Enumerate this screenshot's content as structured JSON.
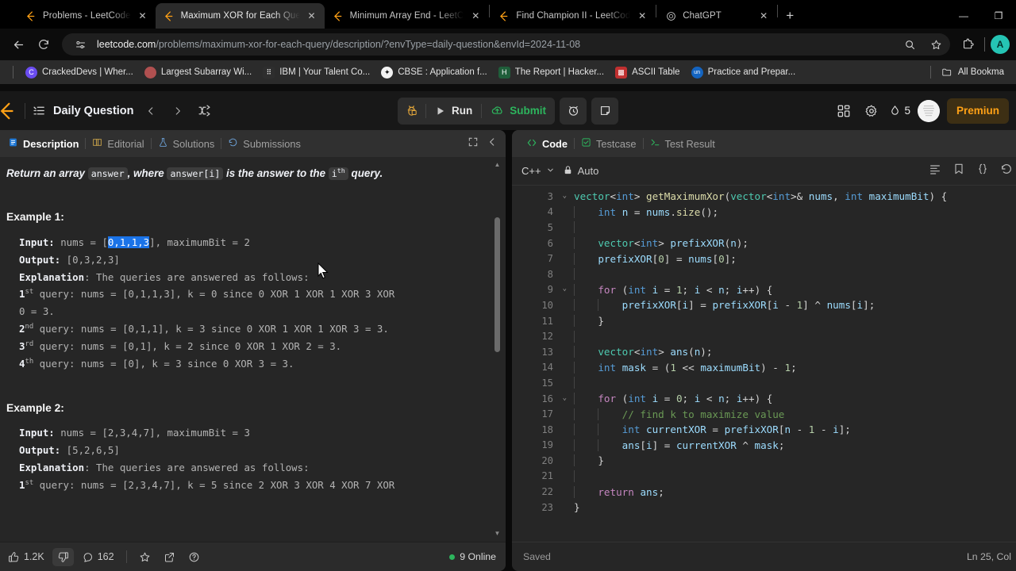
{
  "browser": {
    "tabs": [
      {
        "title": "Problems - LeetCode",
        "icon": "leetcode-icon",
        "active": false
      },
      {
        "title": "Maximum XOR for Each Que",
        "icon": "leetcode-icon",
        "active": true
      },
      {
        "title": "Minimum Array End - LeetC",
        "icon": "leetcode-icon",
        "active": false
      },
      {
        "title": "Find Champion II - LeetCod",
        "icon": "leetcode-icon",
        "active": false
      },
      {
        "title": "ChatGPT",
        "icon": "chatgpt-icon",
        "active": false
      }
    ],
    "new_tab_label": "+",
    "window_controls": [
      "–",
      "❐",
      "✕"
    ],
    "url_domain": "leetcode.com",
    "url_path": "/problems/maximum-xor-for-each-query/description/?envType=daily-question&envId=2024-11-08",
    "bookmarks": [
      {
        "label": "CrackedDevs | Wher...",
        "color": "#6a4cf0",
        "glyph": "C"
      },
      {
        "label": "Largest Subarray Wi...",
        "color": "#b05050",
        "glyph": ""
      },
      {
        "label": "IBM | Your Talent Co...",
        "color": "#3a3a3a",
        "glyph": ""
      },
      {
        "label": "CBSE : Application f...",
        "color": "#1f7a4d",
        "glyph": ""
      },
      {
        "label": "The Report | Hacker...",
        "color": "#1f5e3a",
        "glyph": "H"
      },
      {
        "label": "ASCII Table",
        "color": "#c03030",
        "glyph": ""
      },
      {
        "label": "Practice and Prepar...",
        "color": "#1464c0",
        "glyph": "un"
      }
    ],
    "all_bookmarks_label": "All Bookma"
  },
  "nav": {
    "daily_question": "Daily Question",
    "run_label": "Run",
    "submit_label": "Submit",
    "streak_count": "5",
    "premium_label": "Premiun"
  },
  "description_panel": {
    "tabs": [
      {
        "label": "Description",
        "icon": "document-icon",
        "active": true
      },
      {
        "label": "Editorial",
        "icon": "book-icon",
        "active": false
      },
      {
        "label": "Solutions",
        "icon": "flask-icon",
        "active": false
      },
      {
        "label": "Submissions",
        "icon": "history-icon",
        "active": false
      }
    ],
    "intro": {
      "pre": "Return ",
      "em1": "an array ",
      "chip1": "answer",
      "em2": ", where ",
      "chip2": "answer[i]",
      "em3": " is the answer to the ",
      "chip3": "i",
      "chip3_sup": "th",
      "em4": " query."
    },
    "example1": {
      "title": "Example 1:",
      "input_label": "Input:",
      "input_pre": " nums = [",
      "input_sel": "0,1,1,3",
      "input_post": "], maximumBit = 2",
      "output_label": "Output:",
      "output_value": " [0,3,2,3]",
      "explanation_label": "Explanation",
      "explanation_value": ": The queries are answered as follows:",
      "lines": [
        {
          "ord": "1",
          "sup": "st",
          "text": " query: nums = [0,1,1,3], k = 0 since 0 XOR 1 XOR 1 XOR 3 XOR"
        },
        {
          "ord": "",
          "sup": "",
          "text": "0 = 3."
        },
        {
          "ord": "2",
          "sup": "nd",
          "text": " query: nums = [0,1,1], k = 3 since 0 XOR 1 XOR 1 XOR 3 = 3."
        },
        {
          "ord": "3",
          "sup": "rd",
          "text": " query: nums = [0,1], k = 2 since 0 XOR 1 XOR 2 = 3."
        },
        {
          "ord": "4",
          "sup": "th",
          "text": " query: nums = [0], k = 3 since 0 XOR 3 = 3."
        }
      ]
    },
    "example2": {
      "title": "Example 2:",
      "input_label": "Input:",
      "input_value": " nums = [2,3,4,7], maximumBit = 3",
      "output_label": "Output:",
      "output_value": " [5,2,6,5]",
      "explanation_label": "Explanation",
      "explanation_value": ": The queries are answered as follows:",
      "lines": [
        {
          "ord": "1",
          "sup": "st",
          "text": " query: nums = [2,3,4,7], k = 5 since 2 XOR 3 XOR 4 XOR 7 XOR"
        }
      ]
    },
    "footer": {
      "likes": "1.2K",
      "comments": "162",
      "online": "9 Online"
    }
  },
  "code_panel": {
    "tabs": [
      {
        "label": "Code",
        "icon": "code-icon",
        "active": true
      },
      {
        "label": "Testcase",
        "icon": "checkbox-icon",
        "active": false
      },
      {
        "label": "Test Result",
        "icon": "terminal-icon",
        "active": false
      }
    ],
    "language": "C++",
    "auto_label": "Auto",
    "lines": [
      {
        "num": "3",
        "fold": true,
        "indent": 0,
        "tokens": [
          {
            "t": "vector",
            "c": "t"
          },
          {
            "t": "<",
            "c": "op"
          },
          {
            "t": "int",
            "c": "ty"
          },
          {
            "t": "> ",
            "c": "op"
          },
          {
            "t": "getMaximumXor",
            "c": "fn"
          },
          {
            "t": "(",
            "c": "op"
          },
          {
            "t": "vector",
            "c": "t"
          },
          {
            "t": "<",
            "c": "op"
          },
          {
            "t": "int",
            "c": "ty"
          },
          {
            "t": ">& ",
            "c": "op"
          },
          {
            "t": "nums",
            "c": "v"
          },
          {
            "t": ", ",
            "c": "op"
          },
          {
            "t": "int",
            "c": "ty"
          },
          {
            "t": " ",
            "c": "op"
          },
          {
            "t": "maximumBit",
            "c": "v"
          },
          {
            "t": ") {",
            "c": "op"
          }
        ]
      },
      {
        "num": "4",
        "fold": false,
        "indent": 1,
        "tokens": [
          {
            "t": "    ",
            "c": "op"
          },
          {
            "t": "int",
            "c": "ty"
          },
          {
            "t": " ",
            "c": "op"
          },
          {
            "t": "n",
            "c": "v"
          },
          {
            "t": " = ",
            "c": "op"
          },
          {
            "t": "nums",
            "c": "v"
          },
          {
            "t": ".",
            "c": "op"
          },
          {
            "t": "size",
            "c": "fn"
          },
          {
            "t": "();",
            "c": "op"
          }
        ]
      },
      {
        "num": "5",
        "fold": false,
        "indent": 1,
        "tokens": []
      },
      {
        "num": "6",
        "fold": false,
        "indent": 1,
        "tokens": [
          {
            "t": "    ",
            "c": "op"
          },
          {
            "t": "vector",
            "c": "t"
          },
          {
            "t": "<",
            "c": "op"
          },
          {
            "t": "int",
            "c": "ty"
          },
          {
            "t": "> ",
            "c": "op"
          },
          {
            "t": "prefixXOR",
            "c": "v"
          },
          {
            "t": "(",
            "c": "op"
          },
          {
            "t": "n",
            "c": "v"
          },
          {
            "t": ");",
            "c": "op"
          }
        ]
      },
      {
        "num": "7",
        "fold": false,
        "indent": 1,
        "tokens": [
          {
            "t": "    ",
            "c": "op"
          },
          {
            "t": "prefixXOR",
            "c": "v"
          },
          {
            "t": "[",
            "c": "op"
          },
          {
            "t": "0",
            "c": "n"
          },
          {
            "t": "] = ",
            "c": "op"
          },
          {
            "t": "nums",
            "c": "v"
          },
          {
            "t": "[",
            "c": "op"
          },
          {
            "t": "0",
            "c": "n"
          },
          {
            "t": "];",
            "c": "op"
          }
        ]
      },
      {
        "num": "8",
        "fold": false,
        "indent": 1,
        "tokens": []
      },
      {
        "num": "9",
        "fold": true,
        "indent": 1,
        "tokens": [
          {
            "t": "    ",
            "c": "op"
          },
          {
            "t": "for",
            "c": "k"
          },
          {
            "t": " (",
            "c": "op"
          },
          {
            "t": "int",
            "c": "ty"
          },
          {
            "t": " ",
            "c": "op"
          },
          {
            "t": "i",
            "c": "v"
          },
          {
            "t": " = ",
            "c": "op"
          },
          {
            "t": "1",
            "c": "n"
          },
          {
            "t": "; ",
            "c": "op"
          },
          {
            "t": "i",
            "c": "v"
          },
          {
            "t": " < ",
            "c": "op"
          },
          {
            "t": "n",
            "c": "v"
          },
          {
            "t": "; ",
            "c": "op"
          },
          {
            "t": "i",
            "c": "v"
          },
          {
            "t": "++) {",
            "c": "op"
          }
        ]
      },
      {
        "num": "10",
        "fold": false,
        "indent": 2,
        "tokens": [
          {
            "t": "        ",
            "c": "op"
          },
          {
            "t": "prefixXOR",
            "c": "v"
          },
          {
            "t": "[",
            "c": "op"
          },
          {
            "t": "i",
            "c": "v"
          },
          {
            "t": "] = ",
            "c": "op"
          },
          {
            "t": "prefixXOR",
            "c": "v"
          },
          {
            "t": "[",
            "c": "op"
          },
          {
            "t": "i",
            "c": "v"
          },
          {
            "t": " - ",
            "c": "op"
          },
          {
            "t": "1",
            "c": "n"
          },
          {
            "t": "] ^ ",
            "c": "op"
          },
          {
            "t": "nums",
            "c": "v"
          },
          {
            "t": "[",
            "c": "op"
          },
          {
            "t": "i",
            "c": "v"
          },
          {
            "t": "];",
            "c": "op"
          }
        ]
      },
      {
        "num": "11",
        "fold": false,
        "indent": 1,
        "tokens": [
          {
            "t": "    }",
            "c": "op"
          }
        ]
      },
      {
        "num": "12",
        "fold": false,
        "indent": 1,
        "tokens": []
      },
      {
        "num": "13",
        "fold": false,
        "indent": 1,
        "tokens": [
          {
            "t": "    ",
            "c": "op"
          },
          {
            "t": "vector",
            "c": "t"
          },
          {
            "t": "<",
            "c": "op"
          },
          {
            "t": "int",
            "c": "ty"
          },
          {
            "t": "> ",
            "c": "op"
          },
          {
            "t": "ans",
            "c": "v"
          },
          {
            "t": "(",
            "c": "op"
          },
          {
            "t": "n",
            "c": "v"
          },
          {
            "t": ");",
            "c": "op"
          }
        ]
      },
      {
        "num": "14",
        "fold": false,
        "indent": 1,
        "tokens": [
          {
            "t": "    ",
            "c": "op"
          },
          {
            "t": "int",
            "c": "ty"
          },
          {
            "t": " ",
            "c": "op"
          },
          {
            "t": "mask",
            "c": "v"
          },
          {
            "t": " = (",
            "c": "op"
          },
          {
            "t": "1",
            "c": "n"
          },
          {
            "t": " << ",
            "c": "op"
          },
          {
            "t": "maximumBit",
            "c": "v"
          },
          {
            "t": ") - ",
            "c": "op"
          },
          {
            "t": "1",
            "c": "n"
          },
          {
            "t": ";",
            "c": "op"
          }
        ]
      },
      {
        "num": "15",
        "fold": false,
        "indent": 1,
        "tokens": []
      },
      {
        "num": "16",
        "fold": true,
        "indent": 1,
        "tokens": [
          {
            "t": "    ",
            "c": "op"
          },
          {
            "t": "for",
            "c": "k"
          },
          {
            "t": " (",
            "c": "op"
          },
          {
            "t": "int",
            "c": "ty"
          },
          {
            "t": " ",
            "c": "op"
          },
          {
            "t": "i",
            "c": "v"
          },
          {
            "t": " = ",
            "c": "op"
          },
          {
            "t": "0",
            "c": "n"
          },
          {
            "t": "; ",
            "c": "op"
          },
          {
            "t": "i",
            "c": "v"
          },
          {
            "t": " < ",
            "c": "op"
          },
          {
            "t": "n",
            "c": "v"
          },
          {
            "t": "; ",
            "c": "op"
          },
          {
            "t": "i",
            "c": "v"
          },
          {
            "t": "++) {",
            "c": "op"
          }
        ]
      },
      {
        "num": "17",
        "fold": false,
        "indent": 2,
        "tokens": [
          {
            "t": "        ",
            "c": "op"
          },
          {
            "t": "// find k to maximize value",
            "c": "cm"
          }
        ]
      },
      {
        "num": "18",
        "fold": false,
        "indent": 2,
        "tokens": [
          {
            "t": "        ",
            "c": "op"
          },
          {
            "t": "int",
            "c": "ty"
          },
          {
            "t": " ",
            "c": "op"
          },
          {
            "t": "currentXOR",
            "c": "v"
          },
          {
            "t": " = ",
            "c": "op"
          },
          {
            "t": "prefixXOR",
            "c": "v"
          },
          {
            "t": "[",
            "c": "op"
          },
          {
            "t": "n",
            "c": "v"
          },
          {
            "t": " - ",
            "c": "op"
          },
          {
            "t": "1",
            "c": "n"
          },
          {
            "t": " - ",
            "c": "op"
          },
          {
            "t": "i",
            "c": "v"
          },
          {
            "t": "];",
            "c": "op"
          }
        ]
      },
      {
        "num": "19",
        "fold": false,
        "indent": 2,
        "tokens": [
          {
            "t": "        ",
            "c": "op"
          },
          {
            "t": "ans",
            "c": "v"
          },
          {
            "t": "[",
            "c": "op"
          },
          {
            "t": "i",
            "c": "v"
          },
          {
            "t": "] = ",
            "c": "op"
          },
          {
            "t": "currentXOR",
            "c": "v"
          },
          {
            "t": " ^ ",
            "c": "op"
          },
          {
            "t": "mask",
            "c": "v"
          },
          {
            "t": ";",
            "c": "op"
          }
        ]
      },
      {
        "num": "20",
        "fold": false,
        "indent": 1,
        "tokens": [
          {
            "t": "    }",
            "c": "op"
          }
        ]
      },
      {
        "num": "21",
        "fold": false,
        "indent": 1,
        "tokens": []
      },
      {
        "num": "22",
        "fold": false,
        "indent": 1,
        "tokens": [
          {
            "t": "    ",
            "c": "op"
          },
          {
            "t": "return",
            "c": "k"
          },
          {
            "t": " ",
            "c": "op"
          },
          {
            "t": "ans",
            "c": "v"
          },
          {
            "t": ";",
            "c": "op"
          }
        ]
      },
      {
        "num": "23",
        "fold": false,
        "indent": 0,
        "tokens": [
          {
            "t": "}",
            "c": "op"
          }
        ]
      }
    ],
    "footer": {
      "saved": "Saved",
      "lncol": "Ln 25, Col"
    }
  }
}
